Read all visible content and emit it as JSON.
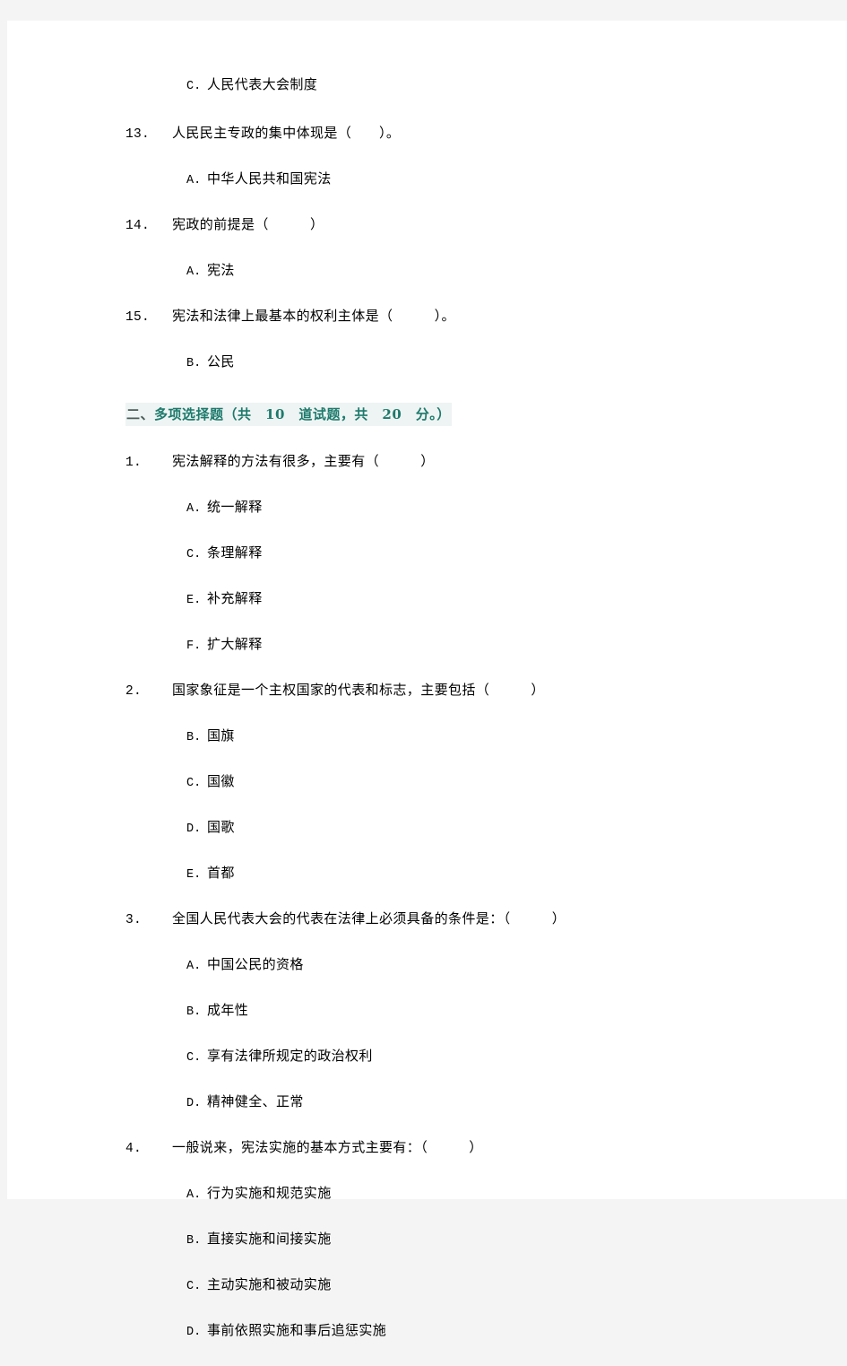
{
  "document": {
    "page_background": "#f4f4f4",
    "sheet_background": "#ffffff",
    "text_color": "#000000"
  },
  "carryover_option": {
    "letter": "C.",
    "text": "人民代表大会制度"
  },
  "single_choice_tail": [
    {
      "number": "13.",
      "stem": "人民民主专政的集中体现是（　　）。",
      "options": [
        {
          "letter": "A.",
          "text": "中华人民共和国宪法"
        }
      ]
    },
    {
      "number": "14.",
      "stem": "宪政的前提是（　　　）",
      "options": [
        {
          "letter": "A.",
          "text": "宪法"
        }
      ]
    },
    {
      "number": "15.",
      "stem": "宪法和法律上最基本的权利主体是（　　　）。",
      "options": [
        {
          "letter": "B.",
          "text": "公民"
        }
      ]
    }
  ],
  "section": {
    "index_label": "二、",
    "title": "多项选择题（共　10　道试题，共　20　分。）",
    "index_color": "#4a5d59",
    "title_color": "#1d7a6c",
    "highlight_color": "#eef4f3"
  },
  "multi_choice": [
    {
      "number": "1.",
      "stem": "宪法解释的方法有很多，主要有（　　　）",
      "options": [
        {
          "letter": "A.",
          "text": "统一解释"
        },
        {
          "letter": "C.",
          "text": "条理解释"
        },
        {
          "letter": "E.",
          "text": "补充解释"
        },
        {
          "letter": "F.",
          "text": "扩大解释"
        }
      ]
    },
    {
      "number": "2.",
      "stem": "国家象征是一个主权国家的代表和标志，主要包括（　　　）",
      "options": [
        {
          "letter": "B.",
          "text": "国旗"
        },
        {
          "letter": "C.",
          "text": "国徽"
        },
        {
          "letter": "D.",
          "text": "国歌"
        },
        {
          "letter": "E.",
          "text": "首都"
        }
      ]
    },
    {
      "number": "3.",
      "stem": "全国人民代表大会的代表在法律上必须具备的条件是：（　　　）",
      "options": [
        {
          "letter": "A.",
          "text": "中国公民的资格"
        },
        {
          "letter": "B.",
          "text": "成年性"
        },
        {
          "letter": "C.",
          "text": "享有法律所规定的政治权利"
        },
        {
          "letter": "D.",
          "text": "精神健全、正常"
        }
      ]
    },
    {
      "number": "4.",
      "stem": "一般说来，宪法实施的基本方式主要有：（　　　）",
      "options": [
        {
          "letter": "A.",
          "text": "行为实施和规范实施"
        },
        {
          "letter": "B.",
          "text": "直接实施和间接实施"
        },
        {
          "letter": "C.",
          "text": "主动实施和被动实施"
        },
        {
          "letter": "D.",
          "text": "事前依照实施和事后追惩实施"
        }
      ]
    }
  ]
}
